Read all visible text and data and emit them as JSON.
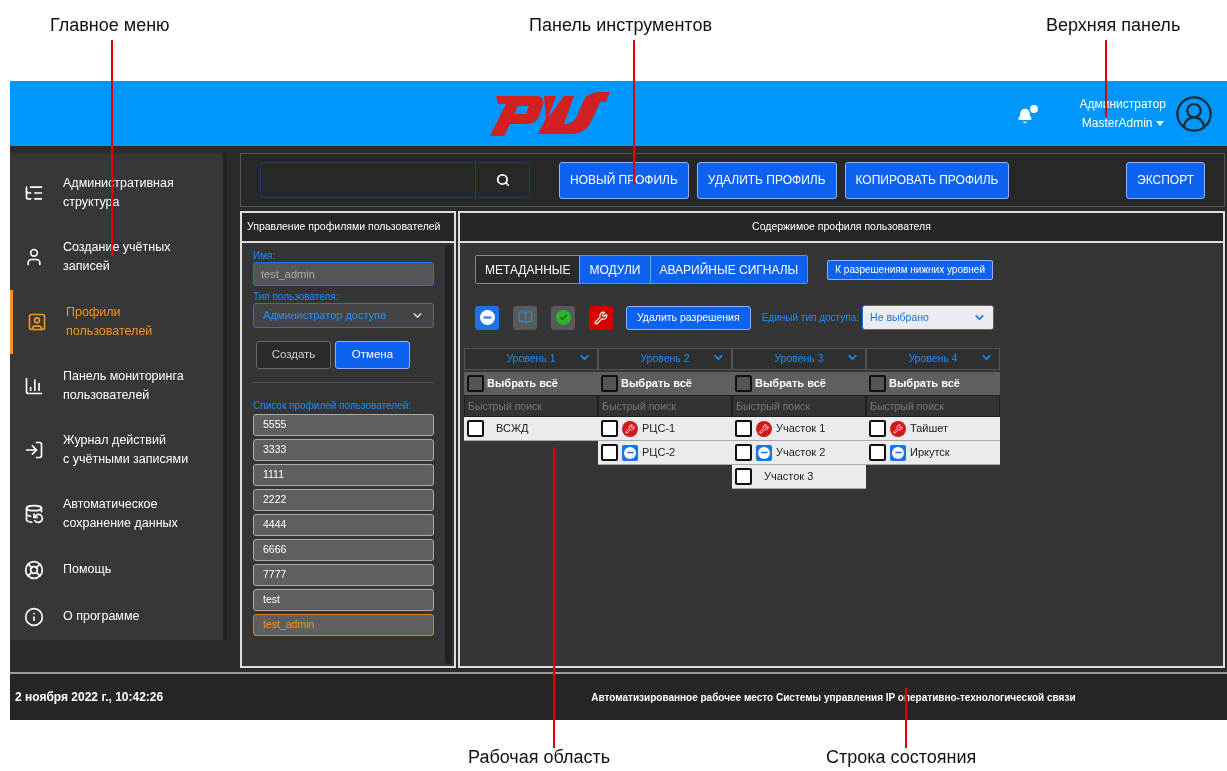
{
  "callouts": [
    {
      "label": "Главное меню"
    },
    {
      "label": "Панель инструментов"
    },
    {
      "label": "Верхняя панель"
    },
    {
      "label": "Рабочая область"
    },
    {
      "label": "Строка состояния"
    }
  ],
  "top_bar": {
    "user_role": "Администратор",
    "user_name": "MasterAdmin",
    "notification": true
  },
  "sidebar": {
    "items": [
      {
        "label": "Административная\nструктура",
        "selected": false
      },
      {
        "label": "Создание учётных\nзаписей",
        "selected": false
      },
      {
        "label": "Профили\nпользователей",
        "selected": true
      },
      {
        "label": "Панель мониторинга\nпользователей",
        "selected": false
      },
      {
        "label": "Журнал действий\nс учётными записями",
        "selected": false
      },
      {
        "label": "Автоматическое\nсохранение данных",
        "selected": false
      },
      {
        "label": "Помощь",
        "selected": false
      },
      {
        "label": "О программе",
        "selected": false
      }
    ]
  },
  "toolbar": {
    "buttons": [
      "НОВЫЙ ПРОФИЛЬ",
      "УДАЛИТЬ ПРОФИЛЬ",
      "КОПИРОВАТЬ ПРОФИЛЬ"
    ],
    "export": "ЭКСПОРТ"
  },
  "profiles_panel": {
    "title": "Управление профилями пользователей",
    "name_label": "Имя:",
    "name_value": "test_admin",
    "type_label": "Тип пользователя:",
    "type_value": "Администратор доступа",
    "buttons": [
      {
        "label": "Создать",
        "kind": "secondary"
      },
      {
        "label": "Отмена",
        "kind": "primary"
      }
    ],
    "list_label": "Список профилей пользователей:",
    "profiles": [
      {
        "label": "5555",
        "selected": false
      },
      {
        "label": "3333",
        "selected": false
      },
      {
        "label": "1111",
        "selected": false
      },
      {
        "label": "2222",
        "selected": false
      },
      {
        "label": "4444",
        "selected": false
      },
      {
        "label": "6666",
        "selected": false
      },
      {
        "label": "7777",
        "selected": false
      },
      {
        "label": "test",
        "selected": false
      },
      {
        "label": "test_admin",
        "selected": true
      }
    ]
  },
  "content_panel": {
    "title": "Содержимое профиля пользователя",
    "tabs": [
      {
        "label": "МЕТАДАННЫЕ",
        "selected": true
      },
      {
        "label": "МОДУЛИ",
        "selected": false
      },
      {
        "label": "АВАРИЙНЫЕ СИГНАЛЫ",
        "selected": false
      }
    ],
    "lower_levels_button": "К разрешениям нижних уровней",
    "permission_buttons": [
      {
        "kind": "deny"
      },
      {
        "kind": "read"
      },
      {
        "kind": "allow"
      },
      {
        "kind": "admin"
      }
    ],
    "delete_button": "Удалить разрешения",
    "access_label": "Единый тип доступа:",
    "access_value": "Не выбрано",
    "levels": [
      {
        "title": "Уровень 1",
        "select_all": "Выбрать всё",
        "select_all_checked": false,
        "search_placeholder": "Быстрый поиск",
        "items": [
          {
            "label": "ВСЖД",
            "checked": false,
            "kind": "plain"
          }
        ]
      },
      {
        "title": "Уровень 2",
        "select_all": "Выбрать всё",
        "select_all_checked": false,
        "search_placeholder": "Быстрый поиск",
        "items": [
          {
            "label": "РЦС-1",
            "checked": false,
            "kind": "admin"
          },
          {
            "label": "РЦС-2",
            "checked": false,
            "kind": "deny"
          }
        ]
      },
      {
        "title": "Уровень 3",
        "select_all": "Выбрать всё",
        "select_all_checked": false,
        "search_placeholder": "Быстрый поиск",
        "items": [
          {
            "label": "Участок 1",
            "checked": false,
            "kind": "admin"
          },
          {
            "label": "Участок 2",
            "checked": false,
            "kind": "deny"
          },
          {
            "label": "Участок 3",
            "checked": false,
            "kind": "plain"
          }
        ]
      },
      {
        "title": "Уровень 4",
        "select_all": "Выбрать всё",
        "select_all_checked": false,
        "search_placeholder": "Быстрый поиск",
        "items": [
          {
            "label": "Тайшет",
            "checked": false,
            "kind": "admin"
          },
          {
            "label": "Иркутск",
            "checked": false,
            "kind": "deny"
          }
        ]
      }
    ]
  },
  "status_bar": {
    "datetime": "2 ноября 2022 г., 10:42:26",
    "app_title": "Автоматизированное рабочее место Системы управления IP оперативно-технологической связи"
  }
}
